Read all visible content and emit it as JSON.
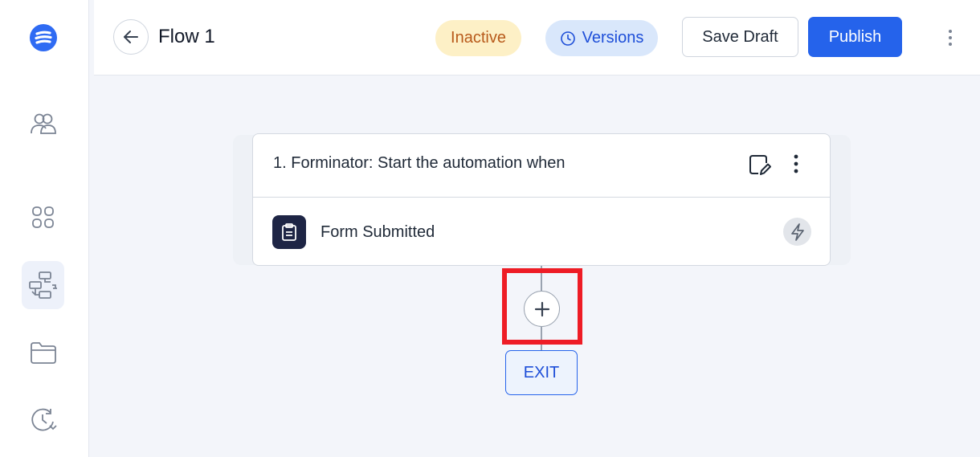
{
  "header": {
    "title": "Flow 1",
    "status_label": "Inactive",
    "versions_label": "Versions",
    "save_draft_label": "Save Draft",
    "publish_label": "Publish"
  },
  "sidebar": {
    "items": [
      {
        "name": "contacts",
        "icon": "users-icon"
      },
      {
        "name": "apps",
        "icon": "grid-icon"
      },
      {
        "name": "automations",
        "icon": "flow-icon",
        "active": true
      },
      {
        "name": "files",
        "icon": "folder-icon"
      },
      {
        "name": "history",
        "icon": "history-icon"
      }
    ]
  },
  "trigger": {
    "title": "1. Forminator: Start the automation when",
    "event_label": "Form Submitted"
  },
  "flow": {
    "exit_label": "EXIT"
  },
  "colors": {
    "accent": "#2563eb",
    "status_bg": "#fdf0c6",
    "status_text": "#b85a1b",
    "versions_bg": "#d9e7fb",
    "highlight": "#ee1c25",
    "canvas_bg": "#f3f5fa"
  }
}
